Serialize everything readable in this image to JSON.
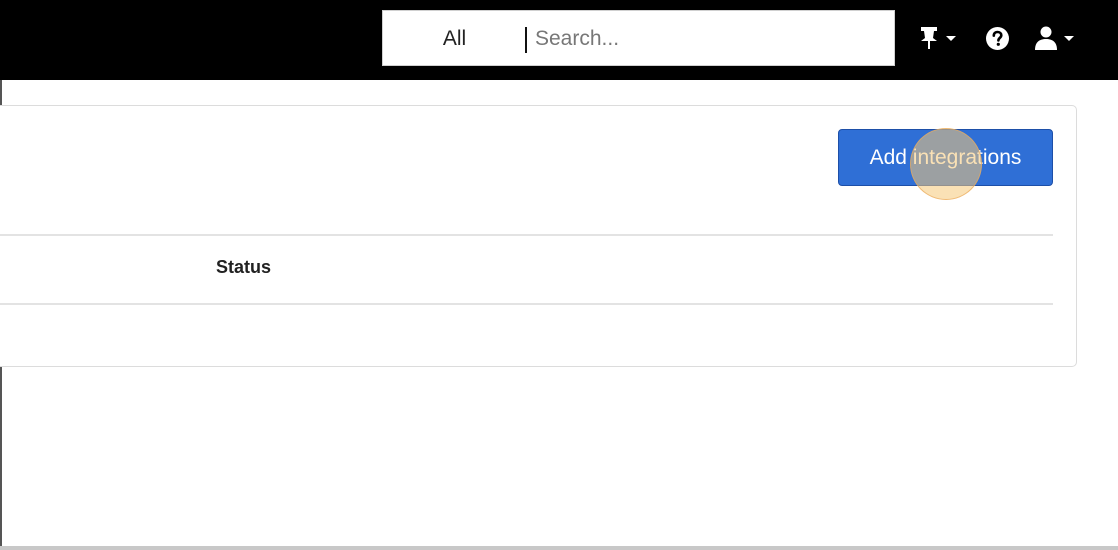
{
  "header": {
    "search": {
      "scope_label": "All",
      "placeholder": "Search..."
    },
    "icons": [
      "pin-icon",
      "help-icon",
      "user-icon"
    ]
  },
  "main": {
    "add_button_label": "Add integrations",
    "table": {
      "columns": [
        "Status"
      ]
    }
  },
  "colors": {
    "topbar": "#000000",
    "primary_button": "#2f6fd6",
    "click_marker": "#f5c878"
  }
}
